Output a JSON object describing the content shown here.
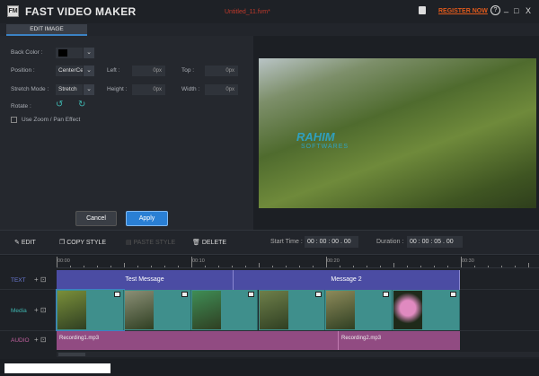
{
  "app": {
    "title": "FAST VIDEO MAKER",
    "logo": "FM",
    "filename": "Untitled_11.fvm*",
    "register": "REGISTER NOW",
    "save_icon": "save-icon",
    "help": "?",
    "minimize": "_",
    "maximize": "□",
    "close": "X"
  },
  "tabs": [
    {
      "label": "EDIT IMAGE",
      "active": true
    }
  ],
  "edit": {
    "back_color_label": "Back Color :",
    "back_color": "#000000",
    "position_label": "Position :",
    "position_value": "CenterCe",
    "left_label": "Left :",
    "left_value": "0px",
    "top_label": "Top :",
    "top_value": "0px",
    "stretch_label": "Stretch Mode :",
    "stretch_value": "Stretch",
    "height_label": "Height :",
    "height_value": "0px",
    "width_label": "Width :",
    "width_value": "0px",
    "rotate_label": "Rotate :",
    "zoom_label": "Use Zoom / Pan Effect",
    "zoom_checked": false,
    "cancel": "Cancel",
    "apply": "Apply"
  },
  "preview": {
    "watermark": "RAHIM",
    "watermark_sub": "SOFTWARES"
  },
  "toolbar": {
    "edit": "EDIT",
    "copy_style": "COPY STYLE",
    "paste_style": "PASTE STYLE",
    "delete": "DELETE",
    "start_time_label": "Start Time :",
    "start_time": "00 : 00 : 00 . 00",
    "duration_label": "Duration :",
    "duration": "00 : 00 : 05 . 00"
  },
  "timeline": {
    "ruler": [
      "00:00",
      "00:10",
      "00:20",
      "00:30"
    ],
    "tracks": {
      "text": "TEXT",
      "media": "Media",
      "audio": "AUDIO"
    },
    "text_clips": [
      "Test Message",
      "Message 2"
    ],
    "media_clips": 6,
    "audio_clips": [
      "Recording1.mp3",
      "Recording2.mp3"
    ]
  },
  "colors": {
    "accent": "#2a7fd4",
    "text_track": "#4b4ca3",
    "media_track": "#3f8f8c",
    "audio_track": "#914b82",
    "register": "#e05a1c"
  }
}
